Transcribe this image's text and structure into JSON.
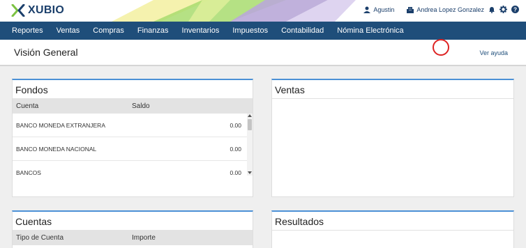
{
  "app": {
    "logo_text": "XUBIO"
  },
  "header": {
    "user_name": "Agustin",
    "company_name": "Andrea Lopez Gonzalez"
  },
  "menu": {
    "items": [
      "Reportes",
      "Ventas",
      "Compras",
      "Finanzas",
      "Inventarios",
      "Impuestos",
      "Contabilidad",
      "Nómina Electrónica"
    ]
  },
  "page": {
    "title": "Visión General",
    "help_link": "Ver ayuda"
  },
  "panels": {
    "fondos": {
      "title": "Fondos",
      "columns": [
        "Cuenta",
        "Saldo"
      ],
      "rows": [
        {
          "account": "BANCO MONEDA EXTRANJERA",
          "amount": "0.00"
        },
        {
          "account": "BANCO MONEDA NACIONAL",
          "amount": "0.00"
        },
        {
          "account": "BANCOS",
          "amount": "0.00"
        }
      ]
    },
    "ventas": {
      "title": "Ventas"
    },
    "cuentas": {
      "title": "Cuentas",
      "columns": [
        "Tipo de Cuenta",
        "Importe"
      ]
    },
    "resultados": {
      "title": "Resultados"
    }
  },
  "colors": {
    "menu_bg": "#1f4e7a",
    "panel_accent": "#4b90d6",
    "logo_green": "#7cc242",
    "logo_blue": "#1b3f6b"
  }
}
